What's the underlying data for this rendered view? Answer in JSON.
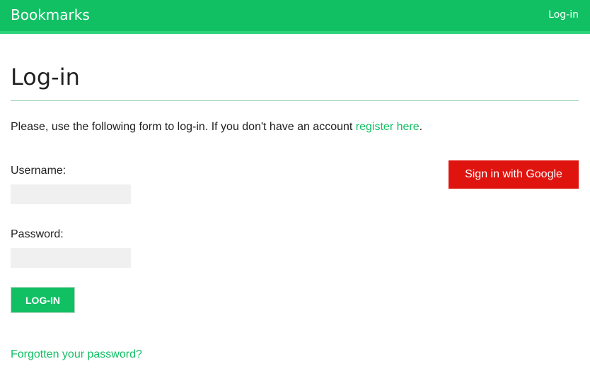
{
  "header": {
    "brand": "Bookmarks",
    "nav_login": "Log-in",
    "color": "#12c064"
  },
  "main": {
    "title": "Log-in",
    "intro_text": "Please, use the following form to log-in. If you don't have an account ",
    "register_link": "register here",
    "intro_end": ".",
    "username_label": "Username:",
    "username_value": "",
    "password_label": "Password:",
    "password_value": "",
    "login_button": "LOG-IN",
    "forgot_link": "Forgotten your password?",
    "google_button": "Sign in with Google",
    "google_color": "#e0140f"
  }
}
